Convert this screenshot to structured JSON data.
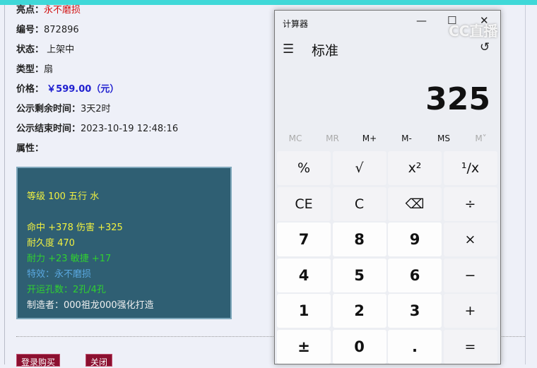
{
  "item": {
    "highlight_label": "亮点：",
    "highlight_value": "永不磨损",
    "id_label": "编号：",
    "id_value": "872896",
    "status_label": "状态：",
    "status_value": "上架中",
    "type_label": "类型：",
    "type_value": "扇",
    "price_label": "价格：",
    "price_value": "￥599.00（元）",
    "remaining_label": "公示剩余时间：",
    "remaining_value": "3天2时",
    "end_label": "公示结束时间：",
    "end_value": "2023-10-19 12:48:16",
    "attr_label": "属性："
  },
  "attributes": [
    "等级 100 五行 水",
    "命中 +378 伤害 +325",
    "耐久度 470",
    "耐力 +23 敏捷 +17",
    "特效：永不磨损",
    "开运孔数：2孔/4孔",
    "制造者：000祖龙000强化打造"
  ],
  "buttons": {
    "login_buy": "登录购买",
    "close": "关闭"
  },
  "calculator": {
    "title": "计算器",
    "mode": "标准",
    "display": "325",
    "memory": [
      "MC",
      "MR",
      "M+",
      "M-",
      "MS",
      "M˅"
    ],
    "keys": [
      "%",
      "√",
      "x²",
      "¹/x",
      "CE",
      "C",
      "⌫",
      "÷",
      "7",
      "8",
      "9",
      "×",
      "4",
      "5",
      "6",
      "−",
      "1",
      "2",
      "3",
      "+",
      "±",
      "0",
      ".",
      "="
    ]
  },
  "watermark": "CC直播"
}
